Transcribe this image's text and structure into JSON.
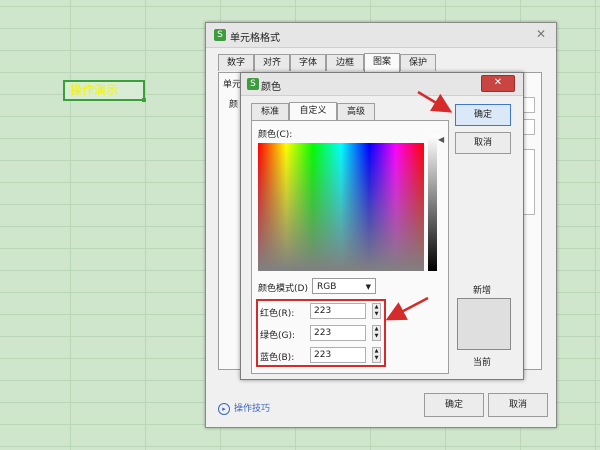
{
  "spreadsheet": {
    "cell_text": "操作演示"
  },
  "format_dialog": {
    "title": "单元格格式",
    "close": "✕",
    "tabs": [
      "数字",
      "对齐",
      "字体",
      "边框",
      "图案",
      "保护"
    ],
    "active_tab": "图案",
    "partial_label1": "单元",
    "partial_label2": "颜",
    "ok": "确定",
    "cancel": "取消",
    "tips": "操作技巧"
  },
  "color_dialog": {
    "title": "颜色",
    "close": "✕",
    "tabs": [
      "标准",
      "自定义",
      "高级"
    ],
    "active_tab": "自定义",
    "color_label": "颜色(C):",
    "mode_label": "颜色模式(D)",
    "mode_value": "RGB",
    "red_label": "红色(R):",
    "red_value": "223",
    "green_label": "绿色(G):",
    "green_value": "223",
    "blue_label": "蓝色(B):",
    "blue_value": "223",
    "ok": "确定",
    "cancel": "取消",
    "new_label": "新增",
    "current_label": "当前",
    "new_color": "#dfdfdf",
    "current_color": "#dfdfdf"
  },
  "colors": {
    "annotation_red": "#d52b2b",
    "app_green": "#3d9c3d"
  }
}
